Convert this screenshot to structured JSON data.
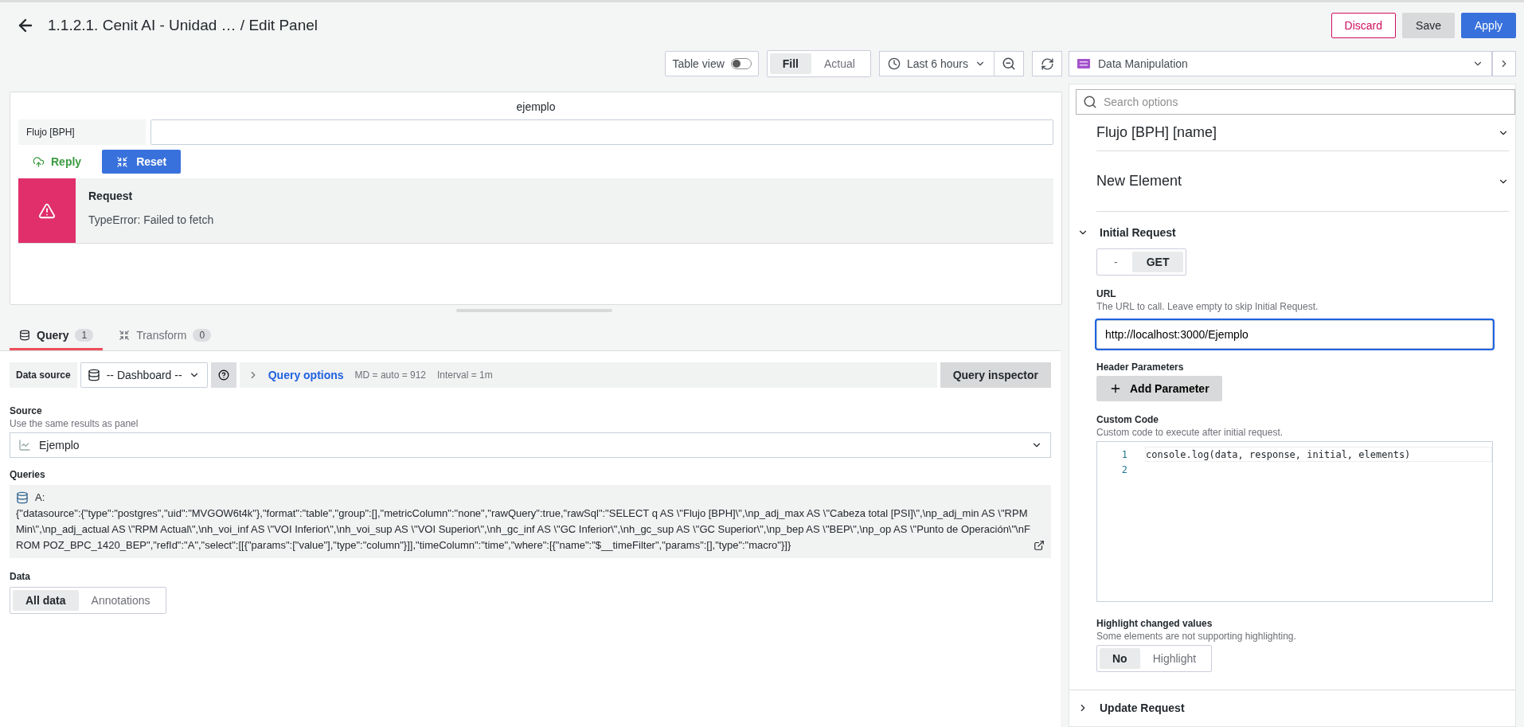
{
  "header": {
    "title": "1.1.2.1. Cenit AI - Unidad … / Edit Panel",
    "buttons": [
      {
        "label": "Discard",
        "kind": "danger"
      },
      {
        "label": "Save",
        "kind": "secondary"
      },
      {
        "label": "Apply",
        "kind": "primary"
      }
    ]
  },
  "toolbar": {
    "table_view": {
      "label": "Table view",
      "on": false
    },
    "size_modes": [
      {
        "label": "Fill",
        "selected": true
      },
      {
        "label": "Actual",
        "selected": false
      }
    ],
    "time_range": "Last 6 hours",
    "visualization": "Data Manipulation"
  },
  "panel": {
    "title": "ejemplo",
    "field": {
      "label": "Flujo [BPH]"
    },
    "reply_button": "Reply",
    "reset_button": "Reset",
    "alert": {
      "title": "Request",
      "message": "TypeError: Failed to fetch"
    }
  },
  "query_tabs": [
    {
      "label": "Query",
      "count": "1",
      "selected": true
    },
    {
      "label": "Transform",
      "count": "0",
      "selected": false
    }
  ],
  "query_row": {
    "data_source_label": "Data source",
    "data_source": "-- Dashboard --",
    "options_label": "Query options",
    "md": "MD = auto = 912",
    "interval": "Interval = 1m",
    "inspector": "Query inspector"
  },
  "source": {
    "label": "Source",
    "description": "Use the same results as panel",
    "value": "Ejemplo"
  },
  "queries": {
    "label": "Queries",
    "ref": "A:",
    "text": "{\"datasource\":{\"type\":\"postgres\",\"uid\":\"MVGOW6t4k\"},\"format\":\"table\",\"group\":[],\"metricColumn\":\"none\",\"rawQuery\":true,\"rawSql\":\"SELECT q AS \\\"Flujo [BPH]\\\",\\np_adj_max AS \\\"Cabeza total [PSI]\\\",\\np_adj_min AS \\\"RPM Min\\\",\\np_adj_actual AS \\\"RPM Actual\\\",\\nh_voi_inf AS \\\"VOI Inferior\\\",\\nh_voi_sup AS \\\"VOI Superior\\\",\\nh_gc_inf AS \\\"GC Inferior\\\",\\nh_gc_sup AS \\\"GC Superior\\\",\\np_bep AS \\\"BEP\\\",\\np_op AS \\\"Punto de Operación\\\"\\nFROM POZ_BPC_1420_BEP\",\"refId\":\"A\",\"select\":[[{\"params\":[\"value\"],\"type\":\"column\"}]],\"timeColumn\":\"time\",\"where\":[{\"name\":\"$__timeFilter\",\"params\":[],\"type\":\"macro\"}]}"
  },
  "data": {
    "label": "Data",
    "options": [
      {
        "label": "All data",
        "selected": true
      },
      {
        "label": "Annotations",
        "selected": false
      }
    ]
  },
  "options_pane": {
    "search": {
      "placeholder": "Search options"
    },
    "sections": [
      {
        "title": "Flujo [BPH] [name]",
        "expanded": false
      },
      {
        "title": "New Element",
        "expanded": false
      }
    ],
    "initial_request": {
      "title": "Initial Request",
      "expanded": true,
      "methods": [
        {
          "label": "-",
          "selected": false
        },
        {
          "label": "GET",
          "selected": true
        }
      ],
      "url_label": "URL",
      "url_description": "The URL to call. Leave empty to skip Initial Request.",
      "url": "http://localhost:3000/Ejemplo",
      "header_label": "Header Parameters",
      "add_parameter": "Add Parameter",
      "code_label": "Custom Code",
      "code_description": "Custom code to execute after initial request.",
      "code_lines": [
        {
          "number": "1",
          "text": "console.log(data, response, initial, elements)"
        },
        {
          "number": "2"
        }
      ],
      "highlight_label": "Highlight changed values",
      "highlight_description": "Some elements are not supporting highlighting.",
      "highlight_options": [
        {
          "label": "No",
          "selected": true
        },
        {
          "label": "Highlight",
          "selected": false
        }
      ]
    },
    "update_request": {
      "title": "Update Request",
      "expanded": false
    }
  }
}
